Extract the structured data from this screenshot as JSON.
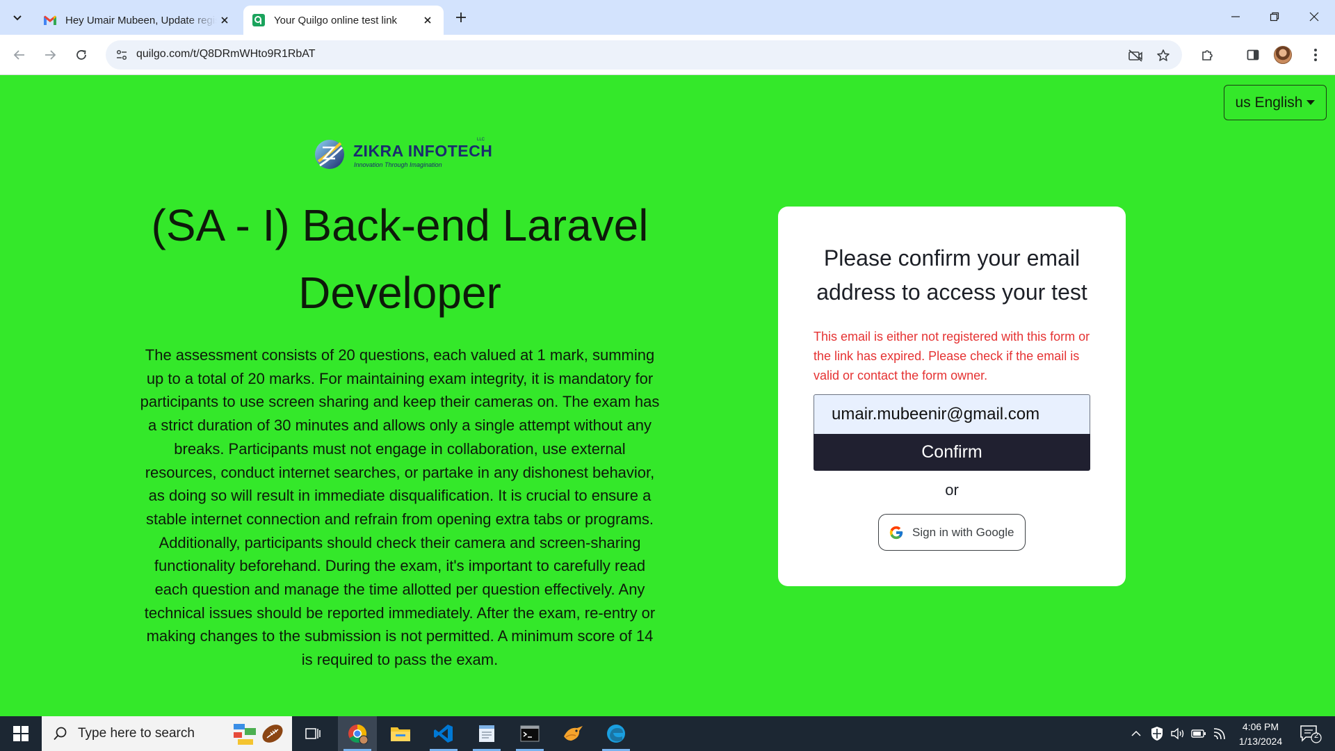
{
  "browser": {
    "tabs": [
      {
        "title": "Hey Umair Mubeen, Update registration",
        "icon": "gmail-icon",
        "active": false
      },
      {
        "title": "Your Quilgo online test link",
        "icon": "quilgo-icon",
        "active": true
      }
    ],
    "url": "quilgo.com/t/Q8DRmWHto9R1RbAT"
  },
  "page": {
    "language_button": "us English",
    "logo": {
      "name": "ZIKRA INFOTECH",
      "suffix": "LLC",
      "tagline": "Innovation Through Imagination"
    },
    "test_title": "(SA - I) Back-end Laravel Developer",
    "description": "The assessment consists of 20 questions, each valued at 1 mark, summing up to a total of 20 marks. For maintaining exam integrity, it is mandatory for participants to use screen sharing and keep their cameras on. The exam has a strict duration of 30 minutes and allows only a single attempt without any breaks. Participants must not engage in collaboration, use external resources, conduct internet searches, or partake in any dishonest behavior, as doing so will result in immediate disqualification. It is crucial to ensure a stable internet connection and refrain from opening extra tabs or programs. Additionally, participants should check their camera and screen-sharing functionality beforehand. During the exam, it's important to carefully read each question and manage the time allotted per question effectively. Any technical issues should be reported immediately. After the exam, re-entry or making changes to the submission is not permitted. A minimum score of 14 is required to pass the exam.",
    "card": {
      "heading": "Please confirm your email address to access your test",
      "error": "This email is either not registered with this form or the link has expired. Please check if the email is valid or contact the form owner.",
      "email_value": "umair.mubeenir@gmail.com",
      "confirm_label": "Confirm",
      "or_label": "or",
      "google_label": "Sign in with Google"
    }
  },
  "taskbar": {
    "search_placeholder": "Type here to search",
    "time": "4:06 PM",
    "date": "1/13/2024",
    "notification_count": "2"
  },
  "colors": {
    "page_background": "#34e82a",
    "error_text": "#e53232",
    "confirm_button": "#202030",
    "tabbar": "#d3e3fd"
  }
}
